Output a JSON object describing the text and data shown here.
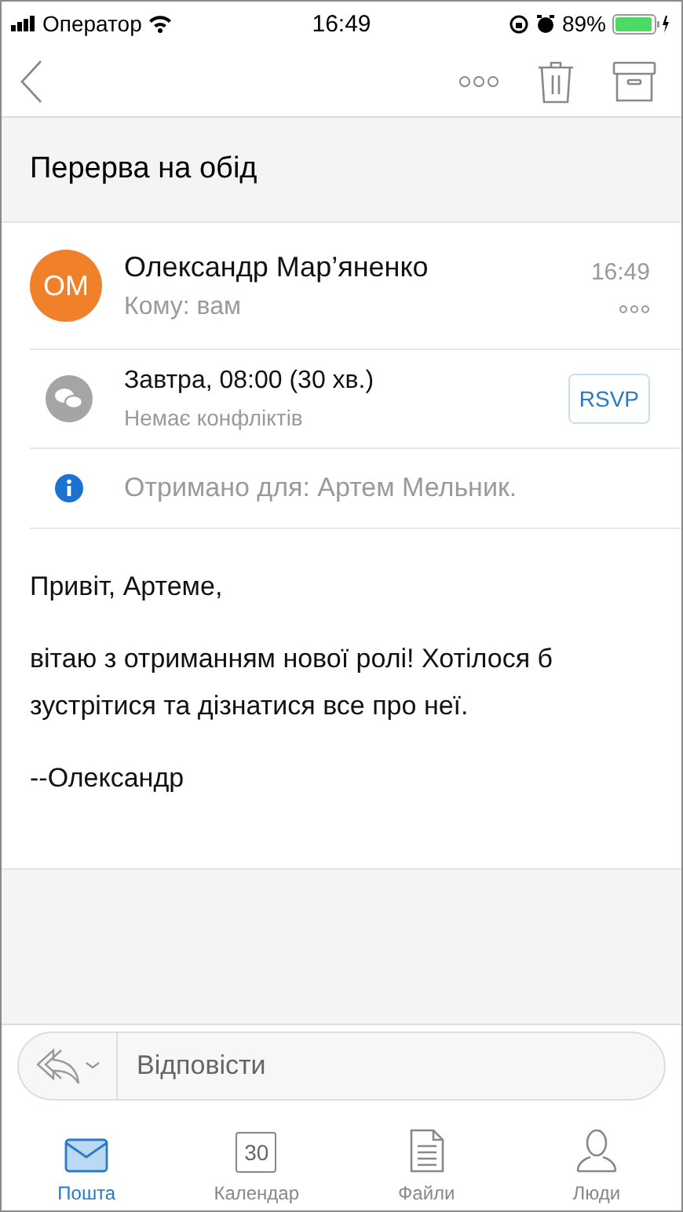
{
  "status_bar": {
    "carrier": "Оператор",
    "time": "16:49",
    "battery": "89%"
  },
  "subject": "Перерва на обід",
  "message": {
    "initials": "ОМ",
    "color": "#f0812a",
    "sender": "Олександр Мар’яненко",
    "time": "16:49",
    "to": "Кому: вам"
  },
  "meeting": {
    "when": "Завтра, 08:00 (30 хв.)",
    "conflicts": "Немає конфліктів",
    "rsvp": "RSVP"
  },
  "info": "Отримано для: Артем Мельник.",
  "body": [
    "Привіт, Артеме,",
    "вітаю з отриманням нової ролі! Хотілося б зустрітися та дізнатися все про неї.",
    "--Олександр"
  ],
  "reply": {
    "placeholder": "Відповісти"
  },
  "tabs": [
    {
      "kind": "mail",
      "label": "Пошта",
      "selected": true
    },
    {
      "kind": "calendar",
      "label": "Календар",
      "icon_text": "30",
      "selected": false
    },
    {
      "kind": "files",
      "label": "Файли",
      "selected": false
    },
    {
      "kind": "people",
      "label": "Люди",
      "selected": false
    }
  ]
}
